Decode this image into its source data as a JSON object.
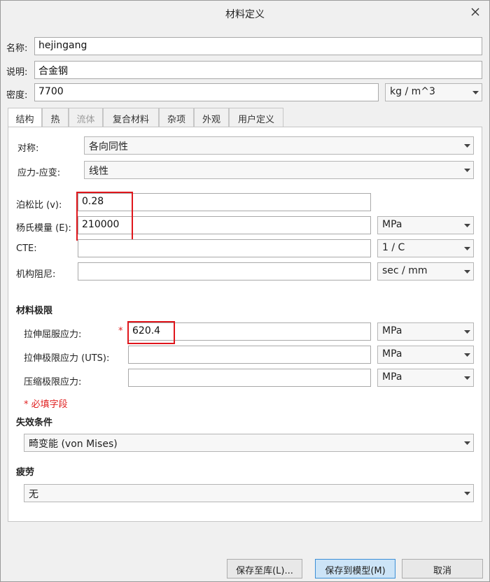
{
  "window": {
    "title": "材料定义"
  },
  "fields": {
    "name": {
      "label": "名称:",
      "value": "hejingang"
    },
    "description": {
      "label": "说明:",
      "value": "合金钢"
    },
    "density": {
      "label": "密度:",
      "value": "7700",
      "unit": "kg / m^3"
    }
  },
  "tabs": [
    {
      "label": "结构",
      "state": "active"
    },
    {
      "label": "热",
      "state": "normal"
    },
    {
      "label": "流体",
      "state": "disabled"
    },
    {
      "label": "复合材料",
      "state": "normal"
    },
    {
      "label": "杂项",
      "state": "normal"
    },
    {
      "label": "外观",
      "state": "normal"
    },
    {
      "label": "用户定义",
      "state": "normal"
    }
  ],
  "structure": {
    "symmetry": {
      "label": "对称:",
      "value": "各向同性"
    },
    "stress_strain": {
      "label": "应力-应变:",
      "value": "线性"
    },
    "poisson": {
      "label": "泊松比 (v):",
      "value": "0.28"
    },
    "youngs": {
      "label": "杨氏模量 (E):",
      "value": "210000",
      "unit": "MPa"
    },
    "cte": {
      "label": "CTE:",
      "value": "",
      "unit": "1 / C"
    },
    "damping": {
      "label": "机构阻尼:",
      "value": "",
      "unit": "sec / mm"
    }
  },
  "limits": {
    "title": "材料极限",
    "tensile_yield": {
      "label": "拉伸屈服应力:",
      "value": "620.4",
      "unit": "MPa",
      "required_mark": "*"
    },
    "tensile_uts": {
      "label": "拉伸极限应力 (UTS):",
      "value": "",
      "unit": "MPa"
    },
    "compressive": {
      "label": "压缩极限应力:",
      "value": "",
      "unit": "MPa"
    },
    "required_note": "* 必填字段"
  },
  "failure": {
    "title": "失效条件",
    "value": "畸变能 (von Mises)"
  },
  "fatigue": {
    "title": "疲劳",
    "value": "无"
  },
  "buttons": {
    "save_library": "保存至库(L)...",
    "save_model": "保存到模型(M)",
    "cancel": "取消"
  },
  "colors": {
    "highlight_box": "#e0161c",
    "required": "#e02020",
    "primary_button": "#cce4f7"
  }
}
